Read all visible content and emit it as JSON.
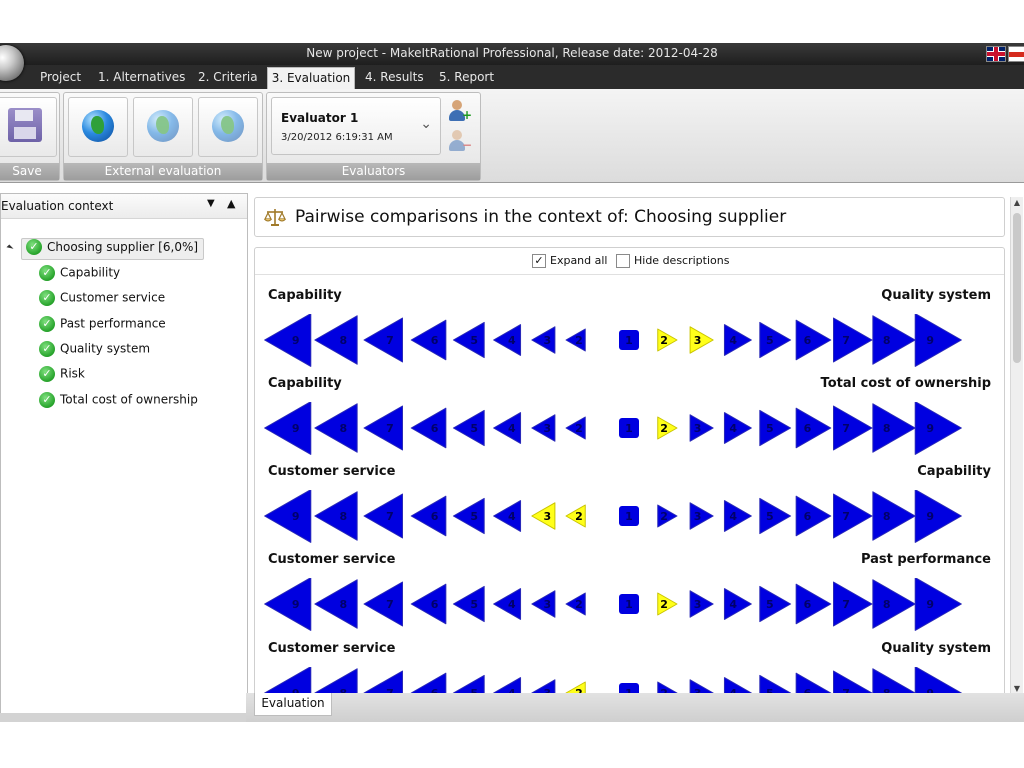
{
  "window": {
    "title": "New project - MakeItRational Professional, Release date: 2012-04-28"
  },
  "menu": [
    {
      "label": "Project",
      "active": false
    },
    {
      "label": "1. Alternatives",
      "active": false
    },
    {
      "label": "2. Criteria",
      "active": false
    },
    {
      "label": "3. Evaluation",
      "active": true
    },
    {
      "label": "4. Results",
      "active": false
    },
    {
      "label": "5. Report",
      "active": false
    }
  ],
  "ribbon": {
    "save_group_label": "Save",
    "external_group_label": "External evaluation",
    "evaluators_group_label": "Evaluators",
    "evaluator_name": "Evaluator 1",
    "evaluator_date": "3/20/2012 6:19:31 AM"
  },
  "context_panel": {
    "title": "Evaluation context",
    "root": "Choosing supplier [6,0%]",
    "children": [
      "Capability",
      "Customer service",
      "Past performance",
      "Quality system",
      "Risk",
      "Total cost of ownership"
    ]
  },
  "main": {
    "header_title": "Pairwise comparisons in the context of: Choosing supplier",
    "expand_all_label": "Expand all",
    "expand_all_checked": true,
    "hide_descriptions_label": "Hide descriptions",
    "hide_descriptions_checked": false,
    "scale_left": [
      9,
      8,
      7,
      6,
      5,
      4,
      3,
      2
    ],
    "scale_center": 1,
    "scale_right": [
      2,
      3,
      4,
      5,
      6,
      7,
      8,
      9
    ],
    "comparisons": [
      {
        "left": "Capability",
        "right": "Quality system",
        "side": "right",
        "value": 3
      },
      {
        "left": "Capability",
        "right": "Total cost of ownership",
        "side": "right",
        "value": 2
      },
      {
        "left": "Customer service",
        "right": "Capability",
        "side": "left",
        "value": 3
      },
      {
        "left": "Customer service",
        "right": "Past performance",
        "side": "right",
        "value": 2
      },
      {
        "left": "Customer service",
        "right": "Quality system",
        "side": "left",
        "value": 2
      }
    ]
  },
  "bottom_tab": "Evaluation",
  "colors": {
    "arrow_blue": "#0000e0",
    "arrow_selected": "#ffff1a",
    "menu_bg": "#2b2b2b"
  }
}
